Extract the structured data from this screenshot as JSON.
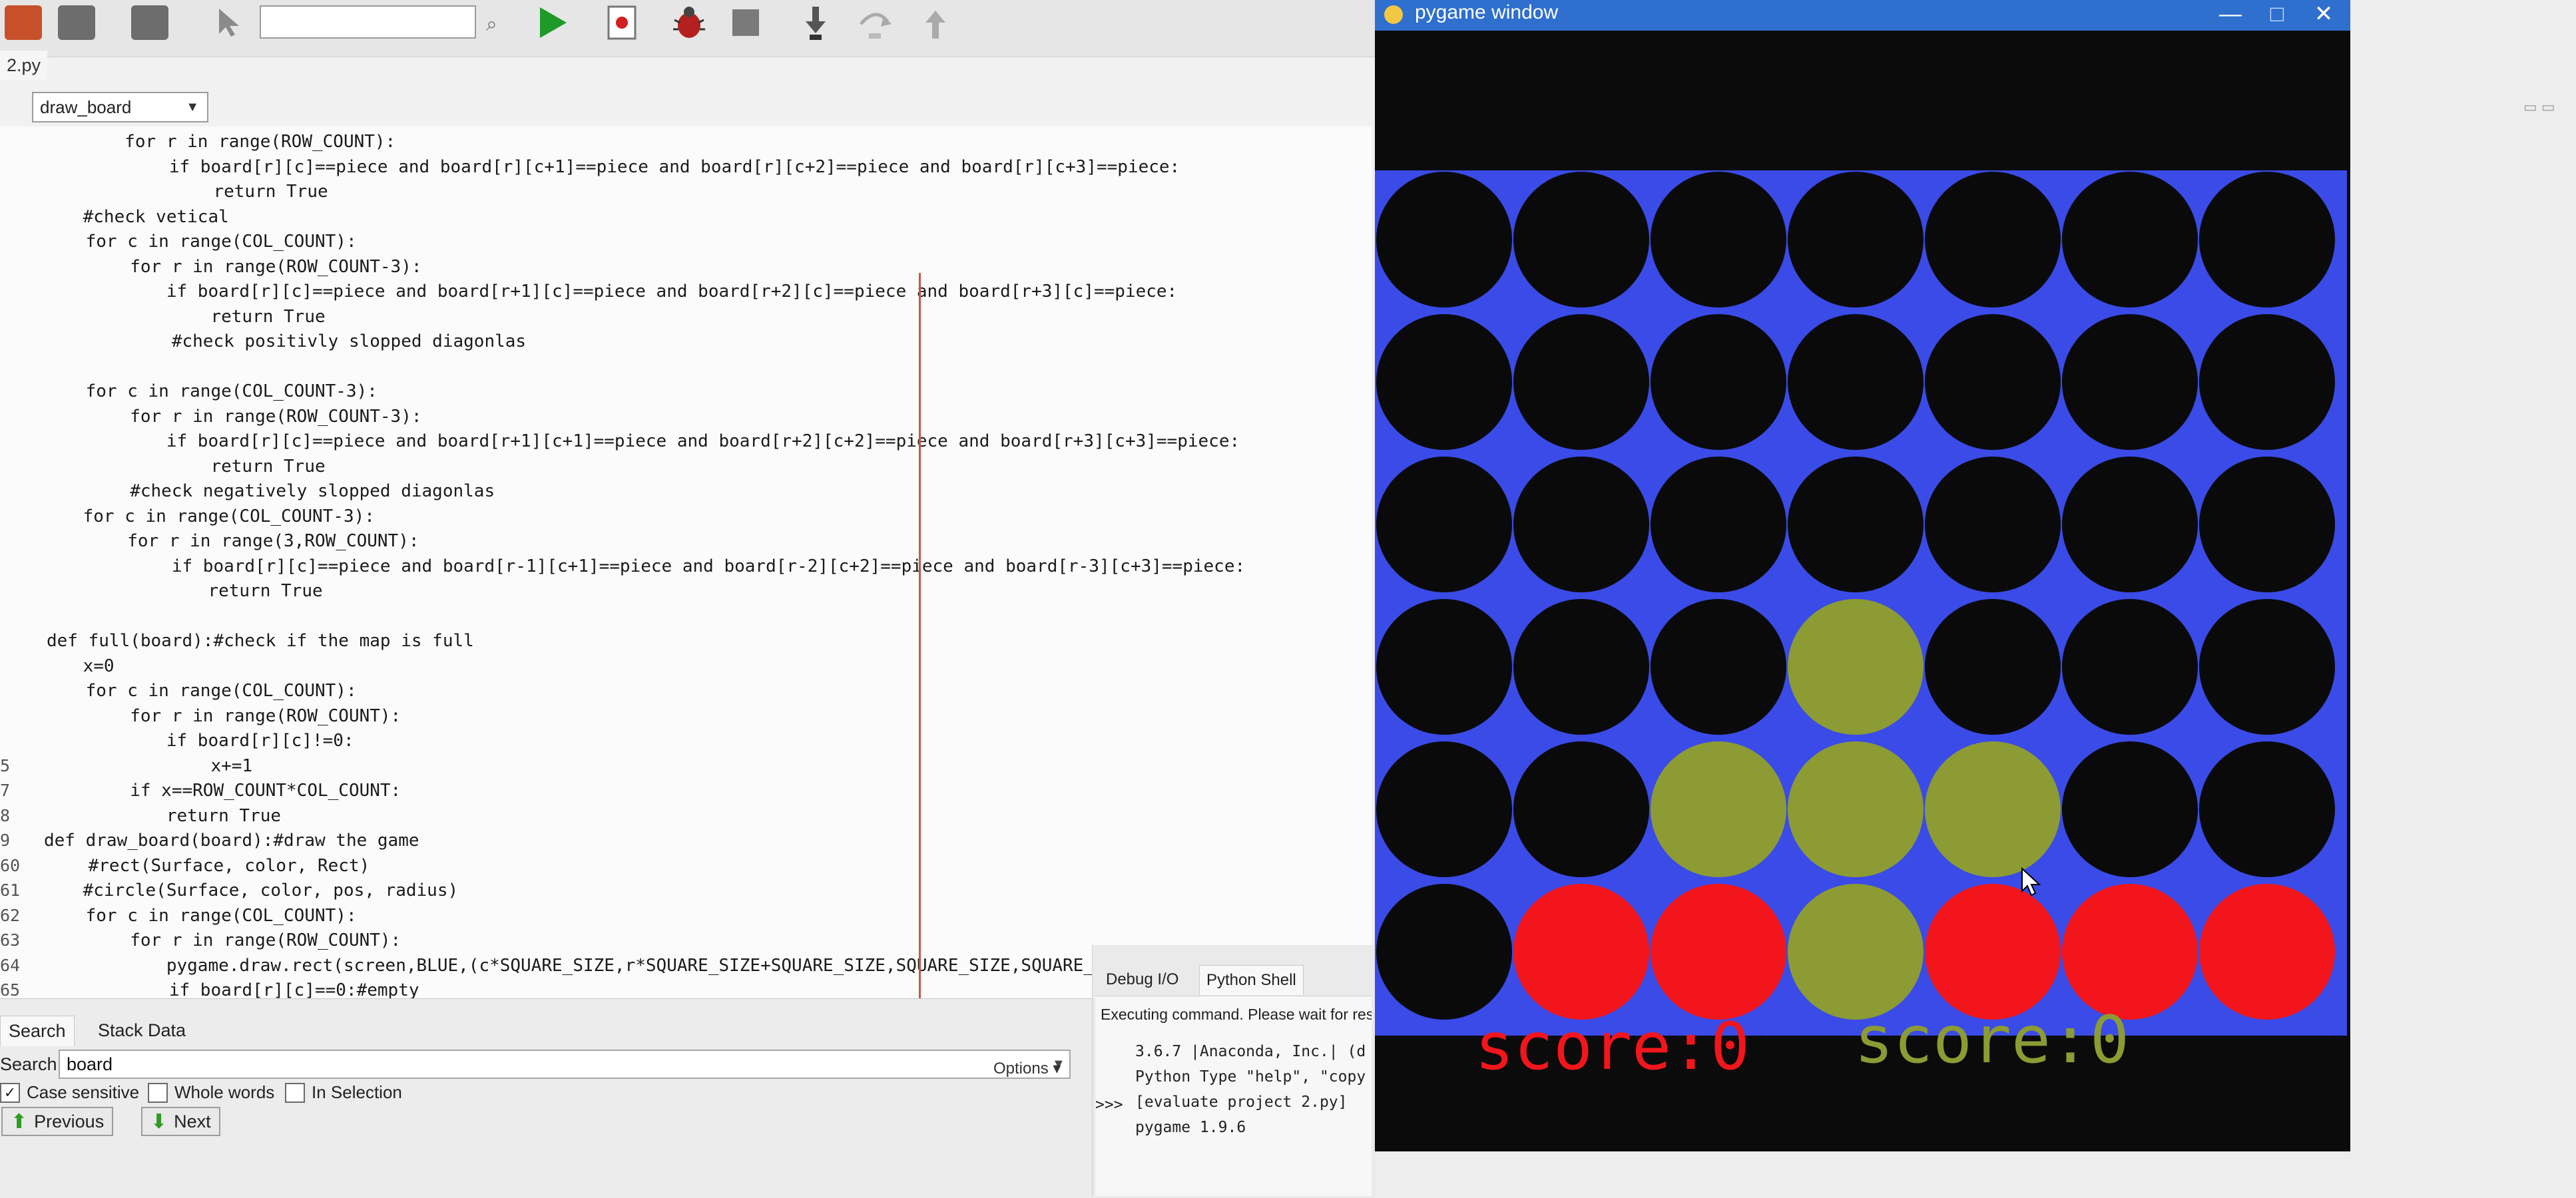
{
  "ide": {
    "filename_tab": "2.py",
    "scope_selector": "draw_board",
    "toolbar_icons": [
      "new-file-icon",
      "open-file-icon",
      "save-icon",
      "pointer-icon",
      "run-icon",
      "record-icon",
      "debug-bug-icon",
      "stop-icon",
      "step-into-icon",
      "step-over-icon",
      "step-out-icon"
    ],
    "code_lines": [
      {
        "ln": "",
        "text": "        for r in range(ROW_COUNT):"
      },
      {
        "ln": "",
        "text": "            if board[r][c]==piece and board[r][c+1]==piece and board[r][c+2]==piece and board[r][c+3]==piece:"
      },
      {
        "ln": "",
        "text": "                return True"
      },
      {
        "ln": "",
        "text": "    #check vetical"
      },
      {
        "ln": "",
        "text": "    for c in range(COL_COUNT):"
      },
      {
        "ln": "",
        "text": "        for r in range(ROW_COUNT-3):"
      },
      {
        "ln": "",
        "text": "            if board[r][c]==piece and board[r+1][c]==piece and board[r+2][c]==piece and board[r+3][c]==piece:"
      },
      {
        "ln": "",
        "text": "                return True"
      },
      {
        "ln": "",
        "text": "            #check positivly slopped diagonlas"
      },
      {
        "ln": "",
        "text": ""
      },
      {
        "ln": "",
        "text": "    for c in range(COL_COUNT-3):"
      },
      {
        "ln": "",
        "text": "        for r in range(ROW_COUNT-3):"
      },
      {
        "ln": "",
        "text": "            if board[r][c]==piece and board[r+1][c+1]==piece and board[r+2][c+2]==piece and board[r+3][c+3]==piece:"
      },
      {
        "ln": "",
        "text": "                return True"
      },
      {
        "ln": "",
        "text": "        #check negatively slopped diagonlas"
      },
      {
        "ln": "",
        "text": "    for c in range(COL_COUNT-3):"
      },
      {
        "ln": "",
        "text": "        for r in range(3,ROW_COUNT):"
      },
      {
        "ln": "",
        "text": "            if board[r][c]==piece and board[r-1][c+1]==piece and board[r-2][c+2]==piece and board[r-3][c+3]==piece:"
      },
      {
        "ln": "",
        "text": "                return True"
      },
      {
        "ln": "",
        "text": ""
      },
      {
        "ln": "",
        "text": "def full(board):#check if the map is full"
      },
      {
        "ln": "",
        "text": "    x=0"
      },
      {
        "ln": "",
        "text": "    for c in range(COL_COUNT):"
      },
      {
        "ln": "",
        "text": "        for r in range(ROW_COUNT):"
      },
      {
        "ln": "",
        "text": "            if board[r][c]!=0:"
      },
      {
        "ln": "5",
        "text": "                x+=1"
      },
      {
        "ln": "7",
        "text": "        if x==ROW_COUNT*COL_COUNT:"
      },
      {
        "ln": "8",
        "text": "            return True"
      },
      {
        "ln": "9",
        "text": "def draw_board(board):#draw the game"
      },
      {
        "ln": "60",
        "text": "    #rect(Surface, color, Rect)"
      },
      {
        "ln": "61",
        "text": "    #circle(Surface, color, pos, radius)"
      },
      {
        "ln": "62",
        "text": "    for c in range(COL_COUNT):"
      },
      {
        "ln": "63",
        "text": "        for r in range(ROW_COUNT):"
      },
      {
        "ln": "64",
        "text": "            pygame.draw.rect(screen,BLUE,(c*SQUARE_SIZE,r*SQUARE_SIZE+SQUARE_SIZE,SQUARE_SIZE,SQUARE_SIZE))"
      },
      {
        "ln": "65",
        "text": "            if board[r][c]==0:#empty"
      }
    ]
  },
  "search_panel": {
    "tabs": [
      "Search",
      "Stack Data"
    ],
    "search_label": "Search:",
    "search_value": "board",
    "options_label": "Options",
    "case_sensitive": {
      "label": "Case sensitive",
      "checked": true
    },
    "whole_words": {
      "label": "Whole words",
      "checked": false
    },
    "in_selection": {
      "label": "In Selection",
      "checked": false
    },
    "previous_label": "Previous",
    "next_label": "Next"
  },
  "shell_panel": {
    "tabs": [
      "Debug I/O",
      "Python Shell"
    ],
    "status": "Executing command.  Please wait for res",
    "lines": [
      "3.6.7 |Anaconda, Inc.| (d",
      "Python Type \"help\", \"copy",
      "[evaluate project 2.py]",
      "pygame 1.9.6"
    ],
    "prompt": ">>>"
  },
  "pygame": {
    "title": "pygame window",
    "minimize": "—",
    "maximize": "□",
    "close": "✕",
    "board_colors": {
      "board": "#3a4be8",
      "empty": "#0a0a0a",
      "red": "#f2161c",
      "yellow": "#8c9b33"
    },
    "board": [
      [
        "E",
        "E",
        "E",
        "E",
        "E",
        "E",
        "E"
      ],
      [
        "E",
        "E",
        "E",
        "E",
        "E",
        "E",
        "E"
      ],
      [
        "E",
        "E",
        "E",
        "E",
        "E",
        "E",
        "E"
      ],
      [
        "E",
        "E",
        "E",
        "Y",
        "E",
        "E",
        "E"
      ],
      [
        "E",
        "E",
        "Y",
        "Y",
        "Y",
        "E",
        "E"
      ],
      [
        "E",
        "R",
        "R",
        "Y",
        "R",
        "R",
        "R"
      ]
    ],
    "score_red": "score:0",
    "score_yellow": "score:0"
  }
}
